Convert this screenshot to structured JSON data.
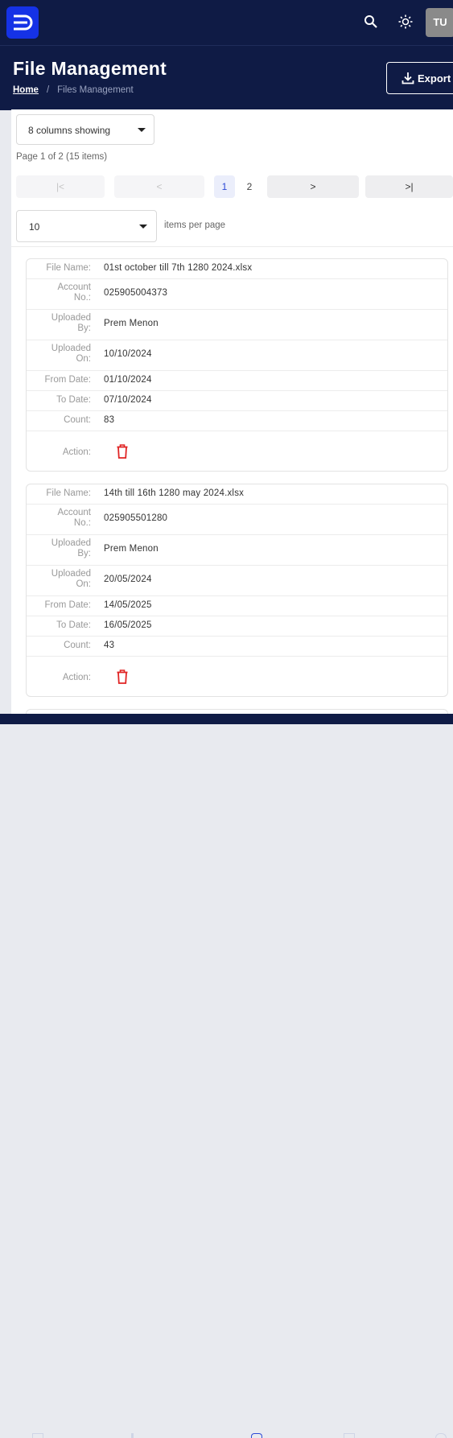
{
  "topbar": {
    "avatar_initials": "TU",
    "icons": [
      "logo-icon",
      "search-icon",
      "sun-icon"
    ]
  },
  "header": {
    "title": "File Management",
    "breadcrumb": {
      "home": "Home",
      "separator": "/",
      "current": "Files Management"
    },
    "export_label": "Export"
  },
  "toolbar": {
    "columns_label": "8 columns showing",
    "page_info": "Page 1 of 2 (15 items)",
    "pagination": {
      "first": "|<",
      "prev": "<",
      "pages": [
        "1",
        "2"
      ],
      "active_page": "1",
      "next": ">",
      "last": ">|"
    },
    "page_size": "10",
    "items_per_page_label": "items per page"
  },
  "labels": {
    "file_name": "File Name:",
    "account_no_1": "Account",
    "account_no_2": "No.:",
    "uploaded_by_1": "Uploaded",
    "uploaded_by_2": "By:",
    "uploaded_on_1": "Uploaded",
    "uploaded_on_2": "On:",
    "from_date": "From Date:",
    "to_date": "To Date:",
    "count": "Count:",
    "action": "Action:"
  },
  "records": [
    {
      "file_name": "01st october till 7th 1280 2024.xlsx",
      "account_no": "025905004373",
      "uploaded_by": "Prem Menon",
      "uploaded_on": "10/10/2024",
      "from_date": "01/10/2024",
      "to_date": "07/10/2024",
      "count": "83"
    },
    {
      "file_name": "14th till 16th 1280 may 2024.xlsx",
      "account_no": "025905501280",
      "uploaded_by": "Prem Menon",
      "uploaded_on": "20/05/2024",
      "from_date": "14/05/2025",
      "to_date": "16/05/2025",
      "count": "43"
    }
  ],
  "colors": {
    "nav_bg": "#0f1b45",
    "brand": "#1532e6",
    "delete": "#e02424",
    "active_page": "#2c49d6"
  }
}
